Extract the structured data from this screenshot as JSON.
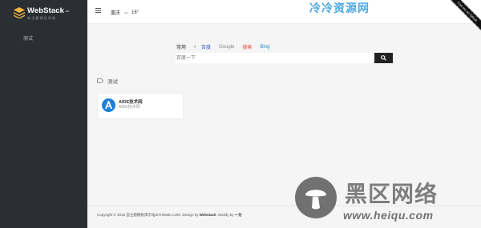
{
  "sidebar": {
    "logo_text": "WebStack",
    "logo_sup": ".cc",
    "logo_sub": "有主题网址导航",
    "items": [
      {
        "label": "测试"
      }
    ]
  },
  "header": {
    "city": "重庆",
    "temperature": "16°"
  },
  "watermark_top": "冷冷资源网",
  "ribbon_text": "Fork me on Github",
  "search": {
    "main_tab": "常用",
    "arrow": "›",
    "engines": [
      "百度",
      "Google",
      "搜索",
      "Bing"
    ],
    "placeholder": "百度一下"
  },
  "section": {
    "title": "测试",
    "cards": [
      {
        "title": "AIDE技术网",
        "desc": "AIDE技术网"
      }
    ]
  },
  "footer": {
    "copyright": "Copyright © 2019 自主题模板演示站ZITHEME.COM",
    "design_by": "Design by",
    "design_name": "Webstack",
    "modify_by": "Modify by",
    "modify_name": "一为"
  },
  "watermark_bottom": {
    "big": "黑区网络",
    "url": "www.heiqu.com"
  },
  "colors": {
    "sidebar_bg": "#2b2f33",
    "card_icon": "#1e7fd8",
    "watermark_blue": "#3aa0e6"
  }
}
